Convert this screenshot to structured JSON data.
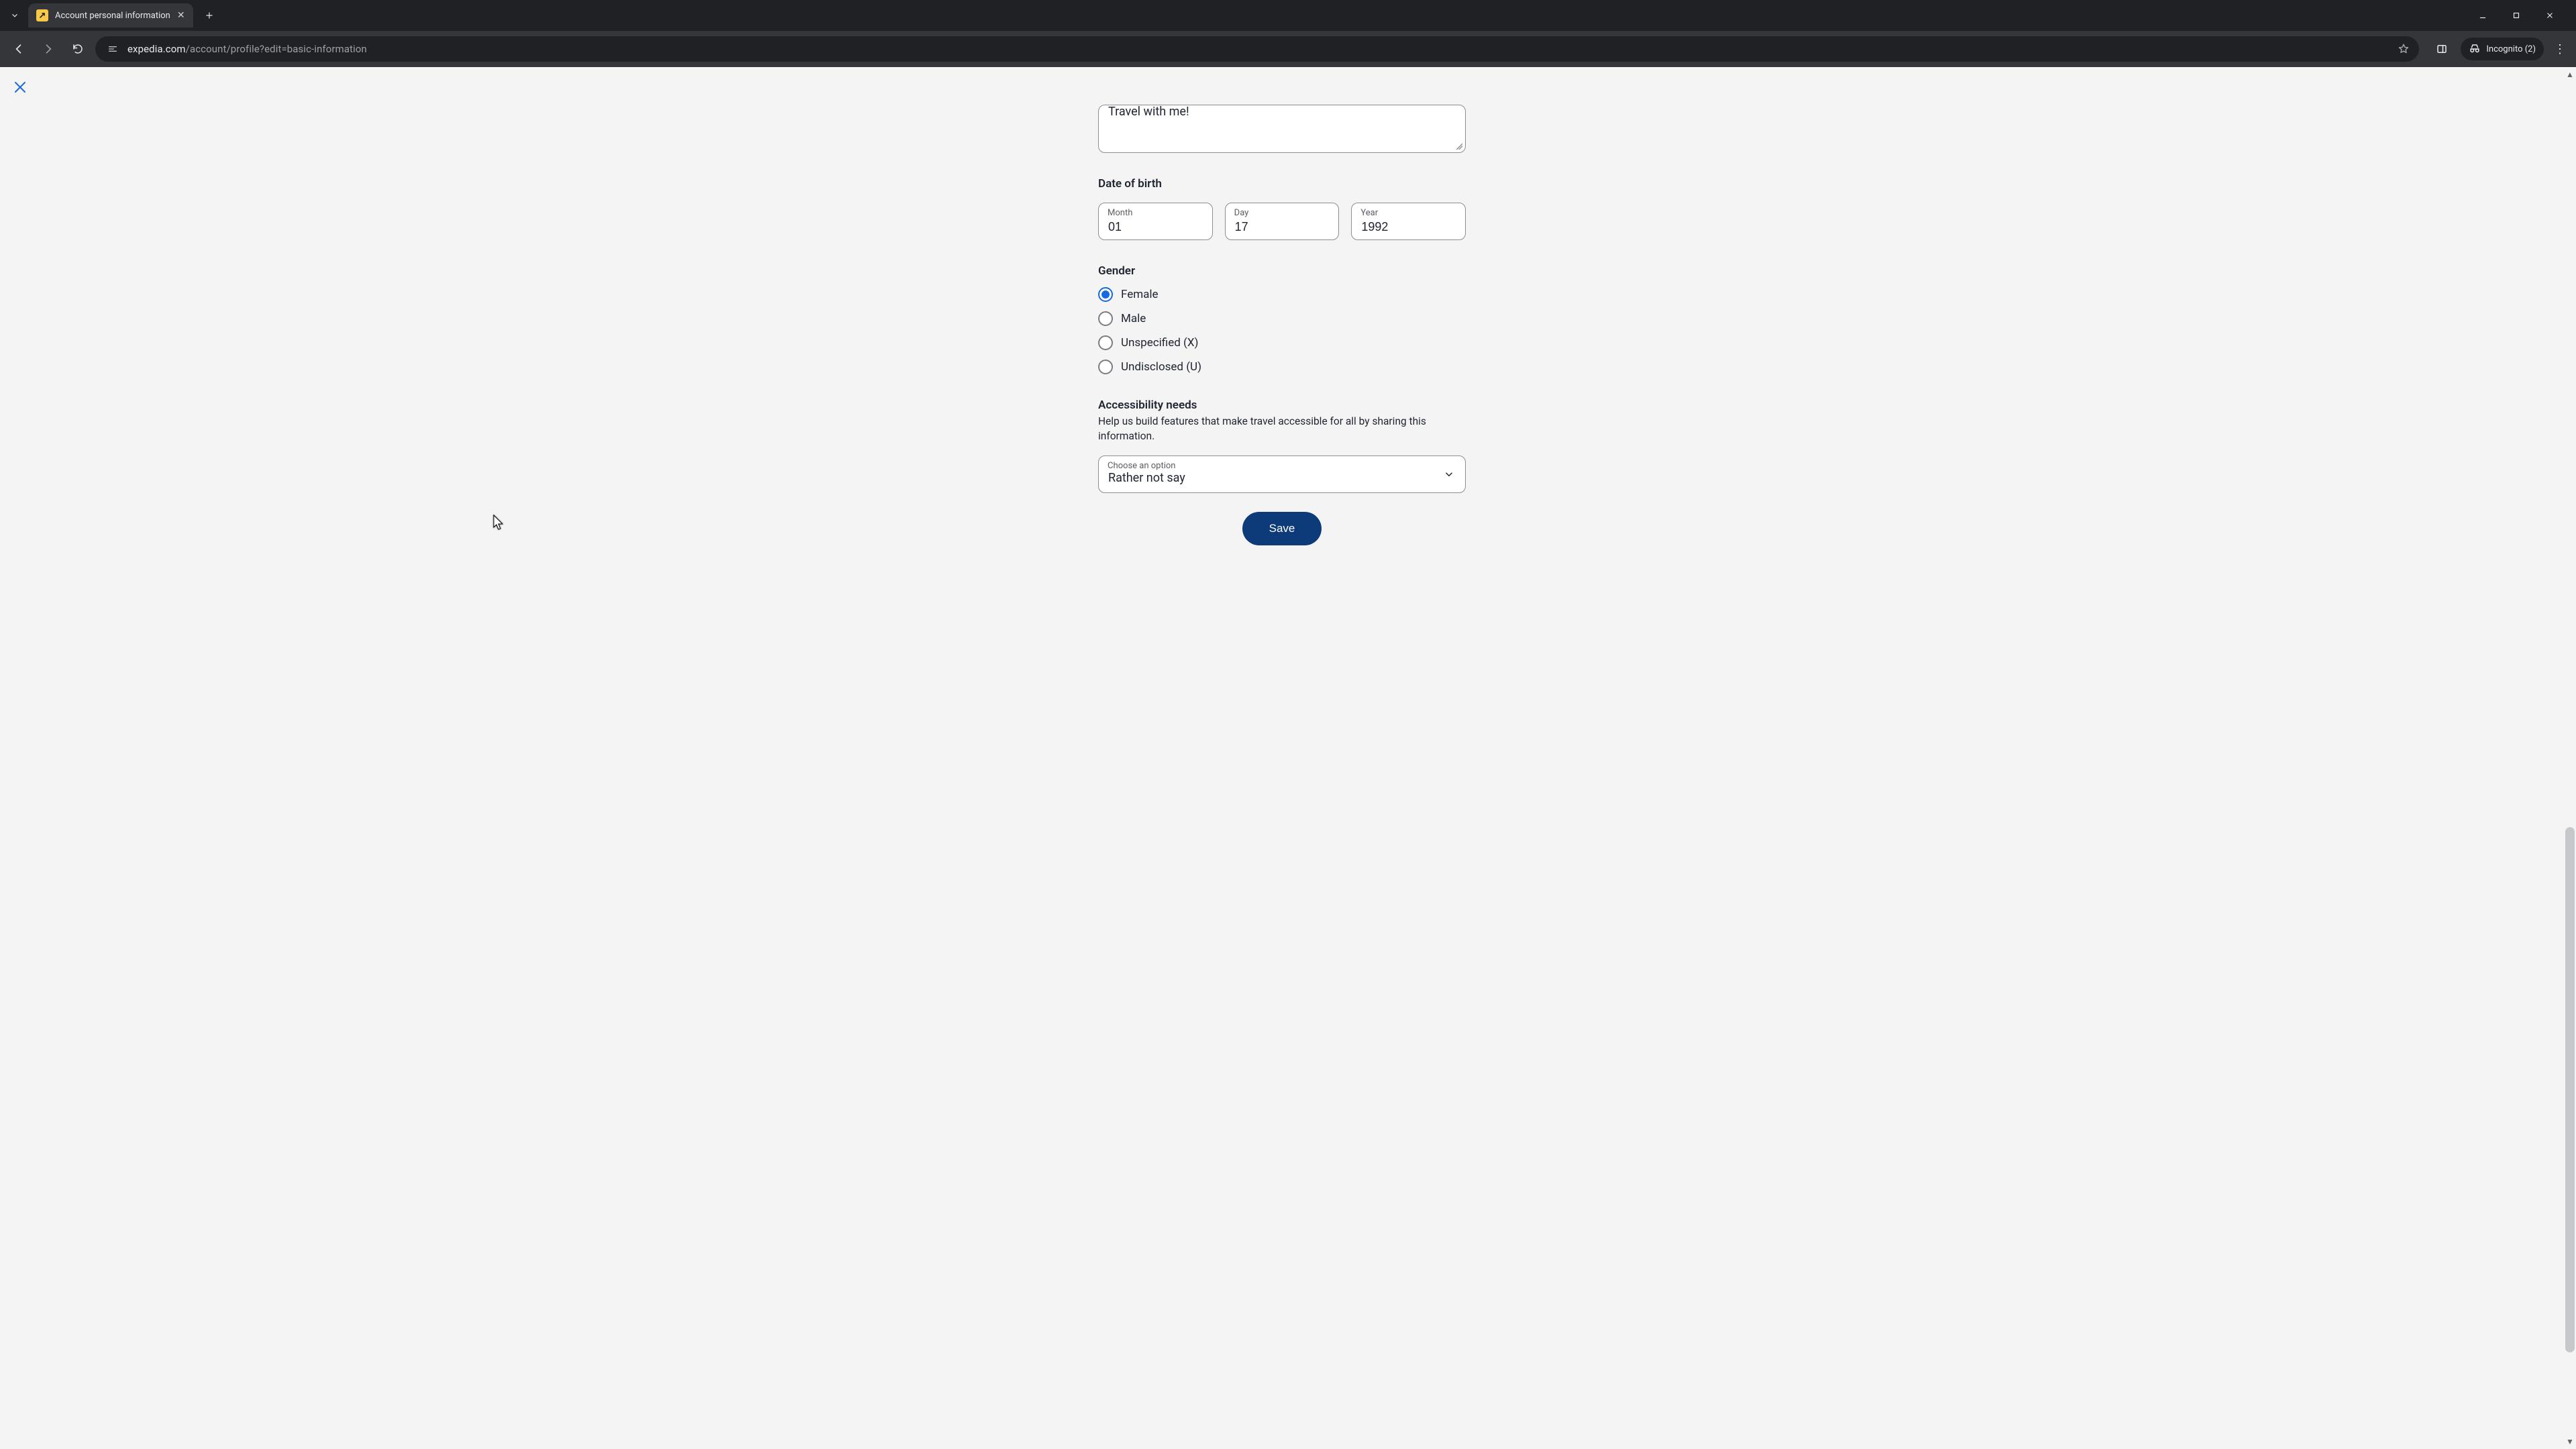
{
  "browser": {
    "tab_title": "Account personal information",
    "favicon_glyph": "↗",
    "url_domain": "expedia.com",
    "url_path": "/account/profile?edit=basic-information",
    "incognito_label": "Incognito (2)"
  },
  "form": {
    "bio_value": "Travel with me!",
    "sections": {
      "dob": {
        "heading": "Date of birth",
        "month_label": "Month",
        "month_value": "01",
        "day_label": "Day",
        "day_value": "17",
        "year_label": "Year",
        "year_value": "1992"
      },
      "gender": {
        "heading": "Gender",
        "options": [
          {
            "label": "Female",
            "checked": true
          },
          {
            "label": "Male",
            "checked": false
          },
          {
            "label": "Unspecified (X)",
            "checked": false
          },
          {
            "label": "Undisclosed (U)",
            "checked": false
          }
        ]
      },
      "accessibility": {
        "heading": "Accessibility needs",
        "subtext": "Help us build features that make travel accessible for all by sharing this information.",
        "select_label": "Choose an option",
        "select_value": "Rather not say"
      }
    },
    "save_label": "Save"
  }
}
